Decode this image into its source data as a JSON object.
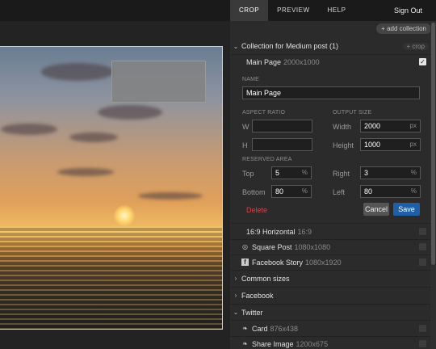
{
  "nav": {
    "tabs": [
      "CROP",
      "PREVIEW",
      "HELP"
    ],
    "sign_out": "Sign Out"
  },
  "toolbar": {
    "add_collection": "+ add collection"
  },
  "collection": {
    "title": "Collection for Medium post (1)",
    "crop_button": "+ crop"
  },
  "crop": {
    "name": "Main Page",
    "size": "2000x1000",
    "checked": true
  },
  "form": {
    "name_label": "NAME",
    "name_value": "Main Page",
    "aspect_label": "ASPECT RATIO",
    "output_label": "OUTPUT SIZE",
    "w_label": "W",
    "h_label": "H",
    "w_value": "",
    "h_value": "",
    "width_label": "Width",
    "width_value": "2000",
    "height_label": "Height",
    "height_value": "1000",
    "px": "px",
    "reserved_label": "RESERVED AREA",
    "top_label": "Top",
    "top_value": "5",
    "right_label": "Right",
    "right_value": "3",
    "bottom_label": "Bottom",
    "bottom_value": "80",
    "left_label": "Left",
    "left_value": "80",
    "pct": "%",
    "delete": "Delete",
    "cancel": "Cancel",
    "save": "Save"
  },
  "crops": [
    {
      "name": "16:9 Horizontal",
      "size": "16:9",
      "icon": ""
    },
    {
      "name": "Square Post",
      "size": "1080x1080",
      "icon": "instagram-icon"
    },
    {
      "name": "Facebook Story",
      "size": "1080x1920",
      "icon": "facebook-icon"
    }
  ],
  "groups": [
    {
      "name": "Common sizes",
      "expanded": false
    },
    {
      "name": "Facebook",
      "expanded": false
    },
    {
      "name": "Twitter",
      "expanded": true
    }
  ],
  "twitter_crops": [
    {
      "name": "Card",
      "size": "876x438",
      "icon": "twitter-icon"
    },
    {
      "name": "Share Image",
      "size": "1200x675",
      "icon": "twitter-icon"
    }
  ],
  "colors": {
    "accent": "#1f5fa8",
    "delete": "#d0454a",
    "panel": "#2b2b2b"
  }
}
